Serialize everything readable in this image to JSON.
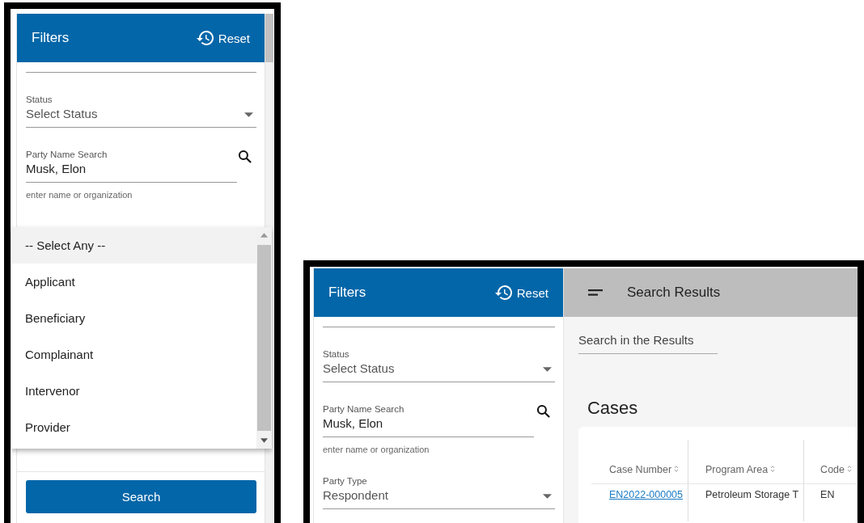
{
  "screens": [
    {
      "filters": {
        "title": "Filters",
        "reset": "Reset",
        "fields": [
          {
            "kind": "date"
          },
          {
            "kind": "select",
            "label": "Status",
            "value": "Select Status"
          },
          {
            "kind": "search",
            "label": "Party Name Search",
            "value": "Musk, Elon",
            "hint": "enter name or organization"
          }
        ]
      },
      "dropdown": {
        "options": [
          {
            "label": "-- Select Any --",
            "selected": true
          },
          {
            "label": "Applicant",
            "selected": false
          },
          {
            "label": "Beneficiary",
            "selected": false
          },
          {
            "label": "Complainant",
            "selected": false
          },
          {
            "label": "Intervenor",
            "selected": false
          },
          {
            "label": "Provider",
            "selected": false
          }
        ]
      },
      "search_button": "Search"
    },
    {
      "filters": {
        "title": "Filters",
        "reset": "Reset",
        "fields": [
          {
            "kind": "date"
          },
          {
            "kind": "select",
            "label": "Status",
            "value": "Select Status"
          },
          {
            "kind": "search",
            "label": "Party Name Search",
            "value": "Musk, Elon",
            "hint": "enter name or organization"
          },
          {
            "kind": "select",
            "label": "Party Type",
            "value": "Respondent"
          }
        ]
      },
      "results": {
        "title": "Search Results",
        "search_placeholder": "Search in the Results",
        "heading": "Cases",
        "table": {
          "columns": [
            {
              "label": "Case Number",
              "kind": "link"
            },
            {
              "label": "Program Area",
              "kind": "text"
            },
            {
              "label": "Code",
              "kind": "text"
            }
          ],
          "rows": [
            [
              "EN2022-000005",
              "Petroleum Storage T",
              "EN"
            ]
          ]
        }
      }
    }
  ]
}
